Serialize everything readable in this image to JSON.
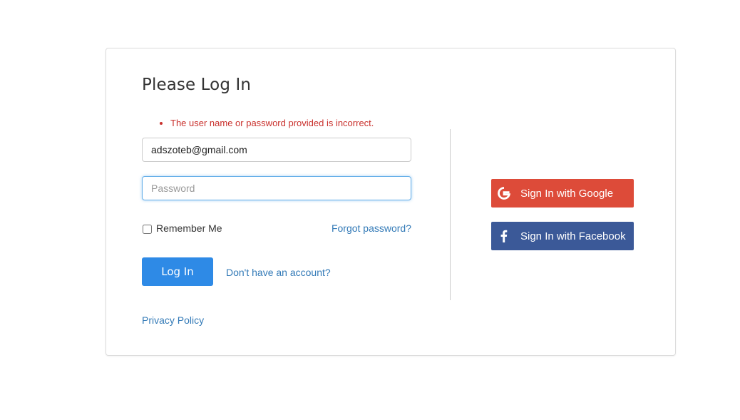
{
  "login": {
    "title": "Please Log In",
    "errors": [
      "The user name or password provided is incorrect."
    ],
    "email": {
      "value": "adszoteb@gmail.com"
    },
    "password": {
      "value": "",
      "placeholder": "Password"
    },
    "remember_label": "Remember Me",
    "remember_checked": false,
    "forgot_label": "Forgot password?",
    "login_label": "Log In",
    "register_label": "Don't have an account?",
    "privacy_label": "Privacy Policy"
  },
  "social": {
    "google": {
      "label": "Sign In with Google",
      "icon": "google-g-icon",
      "color": "#dd4b39"
    },
    "facebook": {
      "label": "Sign In with Facebook",
      "icon": "facebook-f-icon",
      "color": "#3b5998"
    }
  },
  "colors": {
    "error": "#c9302c",
    "link": "#337ab7",
    "primary": "#2e8ae6",
    "focus": "#66afe9"
  }
}
